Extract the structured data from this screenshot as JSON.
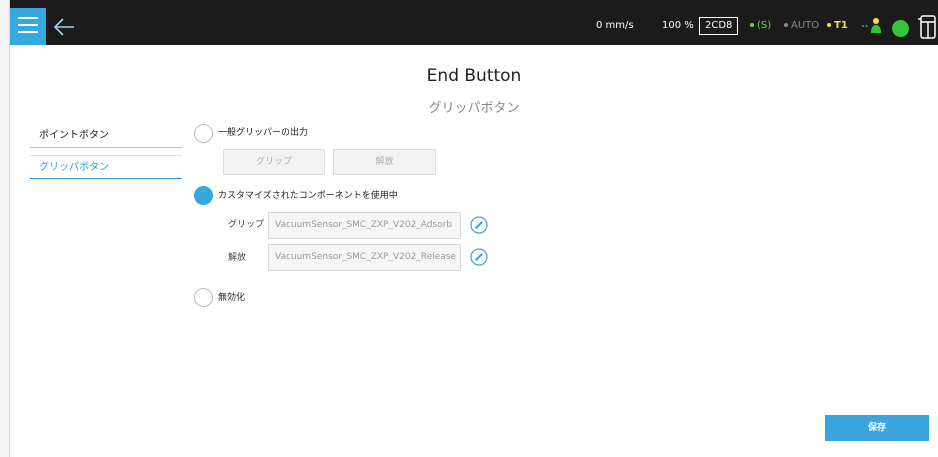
{
  "status_bar": {
    "speed": "0 mm/s",
    "override": "100 %",
    "box_code": "2CD8",
    "servo_symbol": "S",
    "mode": "AUTO",
    "tool": "T1",
    "colors": {
      "accent": "#35a8dd",
      "ok_green": "#37c43a",
      "t1_yellow": "#f2e24a",
      "bar_bg": "#1b1b1b"
    }
  },
  "icons": {
    "menu": "hamburger-icon",
    "back": "arrow-left-icon",
    "robot": "robot-icon",
    "status": "green-status-dot",
    "pendant": "teach-pendant-icon",
    "edit": "pencil-icon"
  },
  "page": {
    "title": "End Button",
    "subtitle": "グリッパボタン"
  },
  "sidebar": {
    "items": [
      {
        "label": "ポイントボタン"
      },
      {
        "label": "グリッパボタン",
        "selected": true
      }
    ]
  },
  "options": {
    "general": {
      "label": "一般グリッパーの出力",
      "selected": false,
      "grip_button": "グリップ",
      "release_button": "解放"
    },
    "custom": {
      "label": "カスタマイズされたコンポーネントを使用中",
      "selected": true,
      "grip_label": "グリップ",
      "grip_value": "VacuumSensor_SMC_ZXP_V202_Adsorb",
      "release_label": "解放",
      "release_value": "VacuumSensor_SMC_ZXP_V202_Release"
    },
    "disabled": {
      "label": "無効化",
      "selected": false
    }
  },
  "footer": {
    "save_label": "保存"
  }
}
